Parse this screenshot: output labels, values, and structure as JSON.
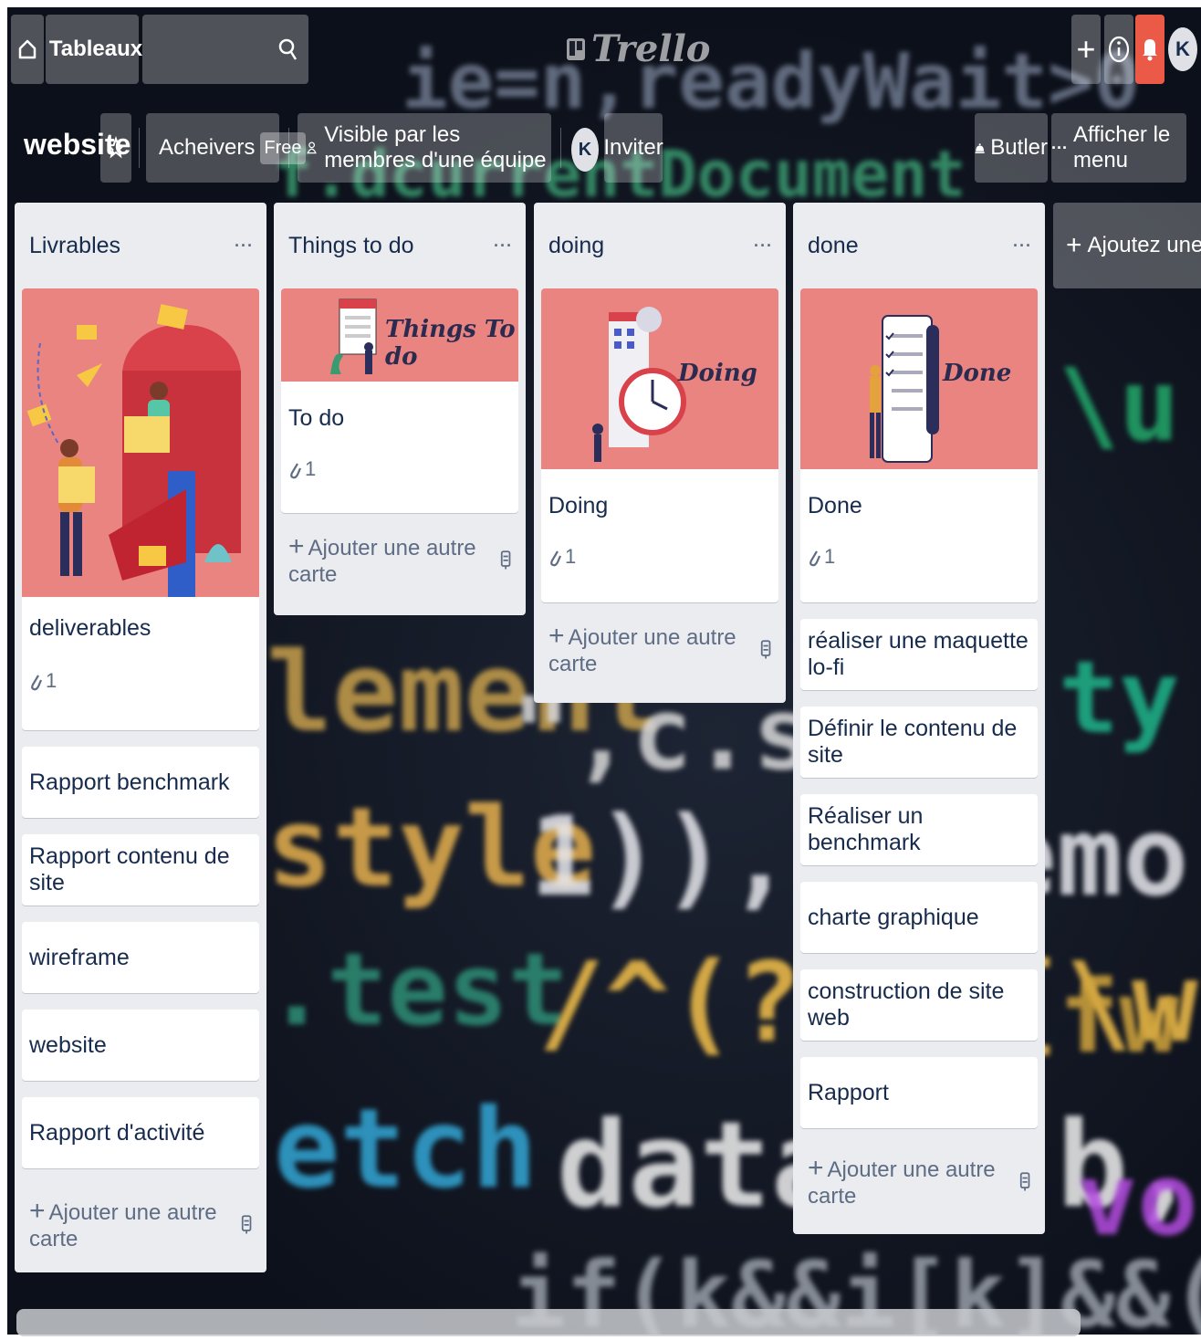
{
  "header": {
    "boards_label": "Tableaux",
    "logo_text": "Trello",
    "avatar_initial": "K"
  },
  "board": {
    "title": "website",
    "team_name": "Acheivers",
    "team_plan": "Free",
    "visibility_label": "Visible par les membres d'une équipe",
    "member_initial": "K",
    "invite_label": "Inviter",
    "butler_label": "Butler",
    "menu_label": "Afficher le menu"
  },
  "lists": [
    {
      "title": "Livrables",
      "more": "···",
      "cover_card": {
        "title": "deliverables",
        "attachments": "1"
      },
      "cards": [
        "Rapport benchmark",
        "Rapport contenu de site",
        "wireframe",
        "website",
        "Rapport d'activité"
      ],
      "add_label": "Ajouter une autre carte"
    },
    {
      "title": "Things to do",
      "more": "···",
      "cover_card": {
        "title": "To do",
        "attachments": "1",
        "cover_text": "Things To do"
      },
      "cards": [],
      "add_label": "Ajouter une autre carte"
    },
    {
      "title": "doing",
      "more": "···",
      "cover_card": {
        "title": "Doing",
        "attachments": "1",
        "cover_text": "Doing"
      },
      "cards": [],
      "add_label": "Ajouter une autre carte"
    },
    {
      "title": "done",
      "more": "···",
      "cover_card": {
        "title": "Done",
        "attachments": "1",
        "cover_text": "Done"
      },
      "cards": [
        "réaliser une maquette lo-fi",
        "Définir le contenu de site",
        "Réaliser un benchmark",
        "charte graphique",
        "construction de site web",
        "Rapport"
      ],
      "add_label": "Ajouter une autre carte"
    }
  ],
  "add_list_label": "Ajoutez une autre l",
  "colors": {
    "list_bg": "#ebecf0",
    "cover_bg": "#ea8481",
    "notification": "#eb5a46"
  },
  "icons": [
    "home-icon",
    "board-icon",
    "search-icon",
    "plus-icon",
    "info-icon",
    "bell-icon",
    "star-icon",
    "visibility-icon",
    "butler-icon",
    "more-icon",
    "paperclip-icon",
    "template-icon"
  ]
}
